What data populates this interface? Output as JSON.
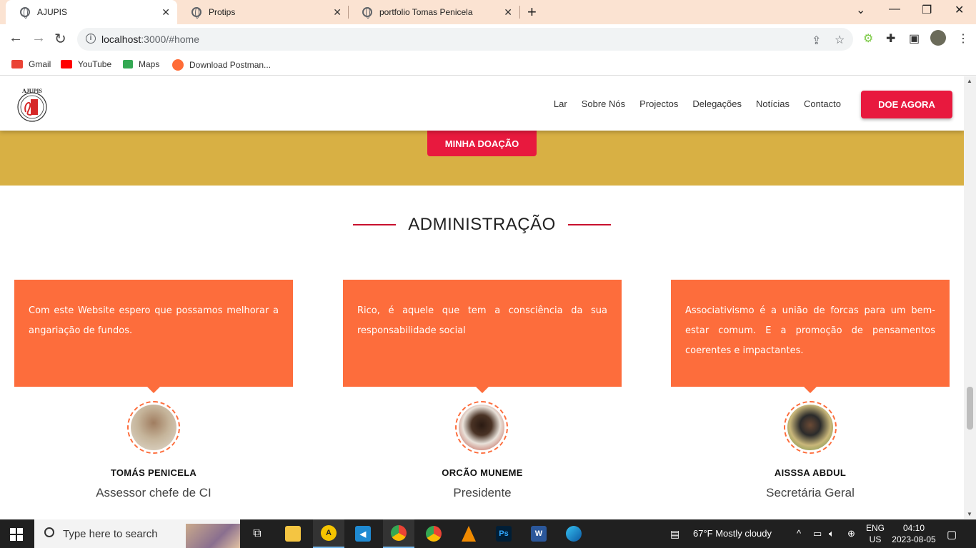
{
  "browser": {
    "tabs": [
      {
        "title": "AJUPIS",
        "active": true
      },
      {
        "title": "Protips",
        "active": false
      },
      {
        "title": "portfolio Tomas Penicela",
        "active": false
      }
    ],
    "url_host": "localhost",
    "url_rest": ":3000/#home",
    "bookmarks": [
      {
        "label": "Gmail",
        "color": "#ea4335"
      },
      {
        "label": "YouTube",
        "color": "#ff0000"
      },
      {
        "label": "Maps",
        "color": "#34a853"
      },
      {
        "label": "Download Postman...",
        "color": "#ff6c37"
      }
    ]
  },
  "site": {
    "logo_text": "AJUPIS",
    "nav": [
      "Lar",
      "Sobre Nós",
      "Projectos",
      "Delegações",
      "Notícias",
      "Contacto"
    ],
    "donate_label": "DOE AGORA",
    "my_donation_label": "MINHA DOAÇÃO",
    "section_title": "ADMINISTRAÇÃO",
    "team": [
      {
        "quote": "Com este Website espero que possamos melhorar a angariação de fundos.",
        "name": "TOMÁS PENICELA",
        "role": "Assessor chefe de CI"
      },
      {
        "quote": "Rico, é aquele que tem a consciência da sua responsabilidade social",
        "name": "ORCÃO MUNEME",
        "role": "Presidente"
      },
      {
        "quote": "Associativismo é a união de forcas para um bem-estar comum. E a promoção de pensamentos coerentes e impactantes.",
        "name": "AISSSA ABDUL",
        "role": "Secretária Geral"
      }
    ],
    "colors": {
      "accent_red": "#e8193e",
      "card_orange": "#fd6d3c",
      "gold_band": "#d8b044"
    }
  },
  "taskbar": {
    "search_placeholder": "Type here to search",
    "weather": "67°F  Mostly cloudy",
    "lang_1": "ENG",
    "lang_2": "US",
    "time": "04:10",
    "date": "2023-08-05"
  }
}
